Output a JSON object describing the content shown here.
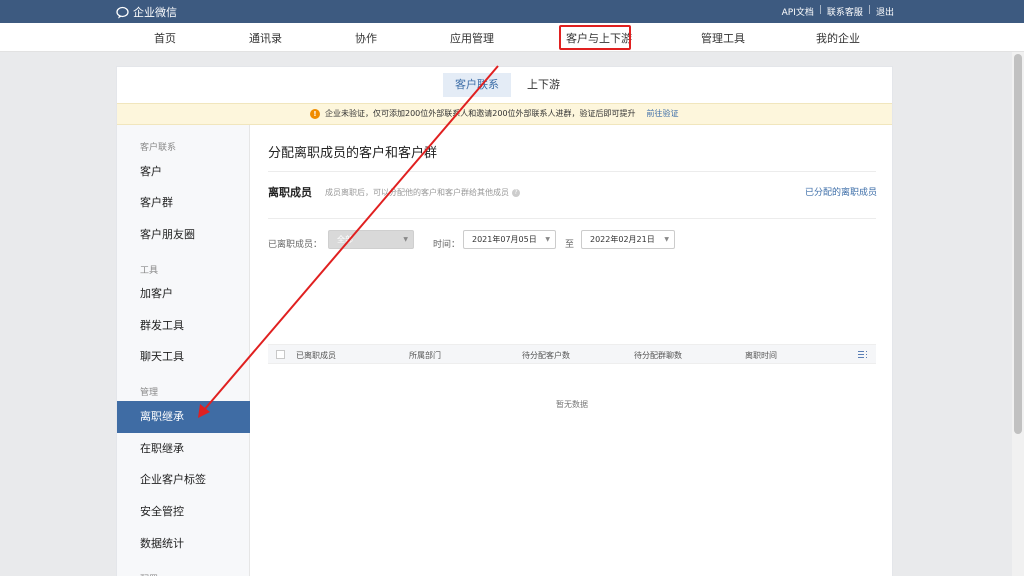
{
  "topbar": {
    "brand": "企业微信",
    "links": [
      "API文档",
      "联系客服",
      "退出"
    ]
  },
  "nav": {
    "items": [
      "首页",
      "通讯录",
      "协作",
      "应用管理",
      "客户与上下游",
      "管理工具",
      "我的企业"
    ],
    "active_index": 4
  },
  "tabs": [
    "客户联系",
    "上下游"
  ],
  "notice": {
    "text": "企业未验证，仅可添加200位外部联系人和邀请200位外部联系人进群，验证后即可提升",
    "link": "前往验证"
  },
  "sidebar": {
    "group1": "客户联系",
    "items1": [
      "客户",
      "客户群",
      "客户朋友圈"
    ],
    "group2": "工具",
    "items2": [
      "加客户",
      "群发工具",
      "聊天工具"
    ],
    "group3": "管理",
    "items3": [
      "离职继承",
      "在职继承",
      "企业客户标签",
      "安全管控",
      "数据统计"
    ],
    "group4": "配置"
  },
  "main": {
    "title": "分配离职成员的客户和客户群",
    "section": "离职成员",
    "section_desc": "成员离职后，可以分配他的客户和客户群给其他成员",
    "assigned_link": "已分配的离职成员"
  },
  "filters": {
    "member_label": "已离职成员：",
    "member_value": "全部",
    "time_label": "时间：",
    "start_date": "2021年07月05日",
    "to_label": "至",
    "end_date": "2022年02月21日"
  },
  "table": {
    "headers": [
      "已离职成员",
      "所属部门",
      "待分配客户数",
      "待分配群聊数",
      "离职时间"
    ],
    "empty_text": "暂无数据"
  },
  "colors": {
    "topbar": "#3d5a80",
    "active_sidebar": "#3f6ca4",
    "highlight": "#e02020"
  }
}
